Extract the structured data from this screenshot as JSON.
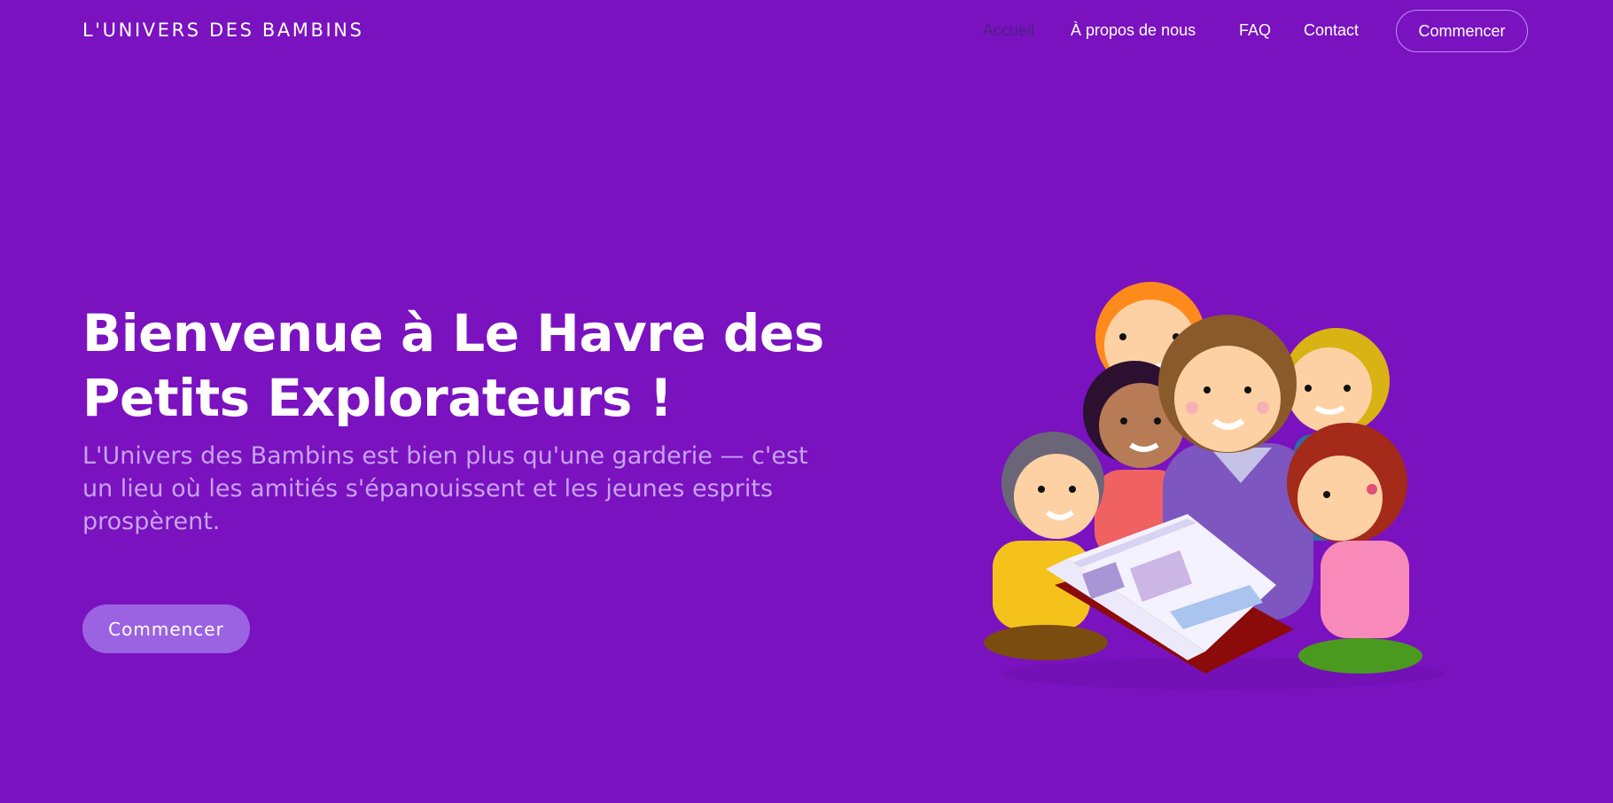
{
  "brand": {
    "name": "L'UNIVERS DES BAMBINS"
  },
  "nav": {
    "items": [
      {
        "label": "Accueil",
        "active": true
      },
      {
        "label": "À propos de nous",
        "active": false
      },
      {
        "label": "FAQ",
        "active": false
      },
      {
        "label": "Contact",
        "active": false
      }
    ],
    "cta_label": "Commencer"
  },
  "hero": {
    "title": "Bienvenue à Le Havre des Petits Explorateurs !",
    "subtitle": "L'Univers des Bambins est bien plus qu'une garderie — c'est un lieu où les amitiés s'épanouissent et les jeunes esprits prospèrent.",
    "cta_label": "Commencer"
  },
  "colors": {
    "background": "#7a12c0",
    "active_nav": "#4e1f86",
    "subtitle": "#c7a2ee",
    "button": "#9b63e2"
  },
  "illustration": {
    "icon": "children-reading-book-illustration"
  }
}
